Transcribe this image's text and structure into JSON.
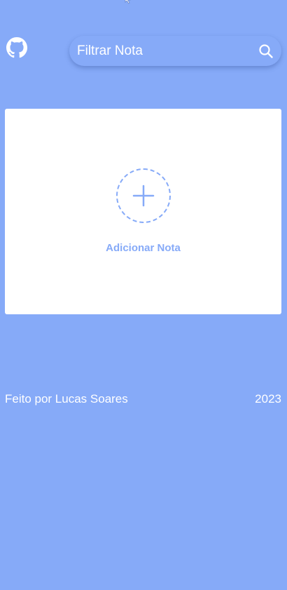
{
  "header": {
    "github_icon": "github-icon",
    "search": {
      "placeholder": "Filtrar Nota",
      "value": "",
      "icon": "search-icon"
    }
  },
  "main": {
    "add_note": {
      "icon": "plus-icon",
      "label": "Adicionar Nota"
    }
  },
  "footer": {
    "credit": "Feito por Lucas Soares",
    "year": "2023"
  },
  "colors": {
    "background": "#86aaf8",
    "card": "#ffffff",
    "accent": "#86aaf8",
    "text": "#ffffff"
  }
}
